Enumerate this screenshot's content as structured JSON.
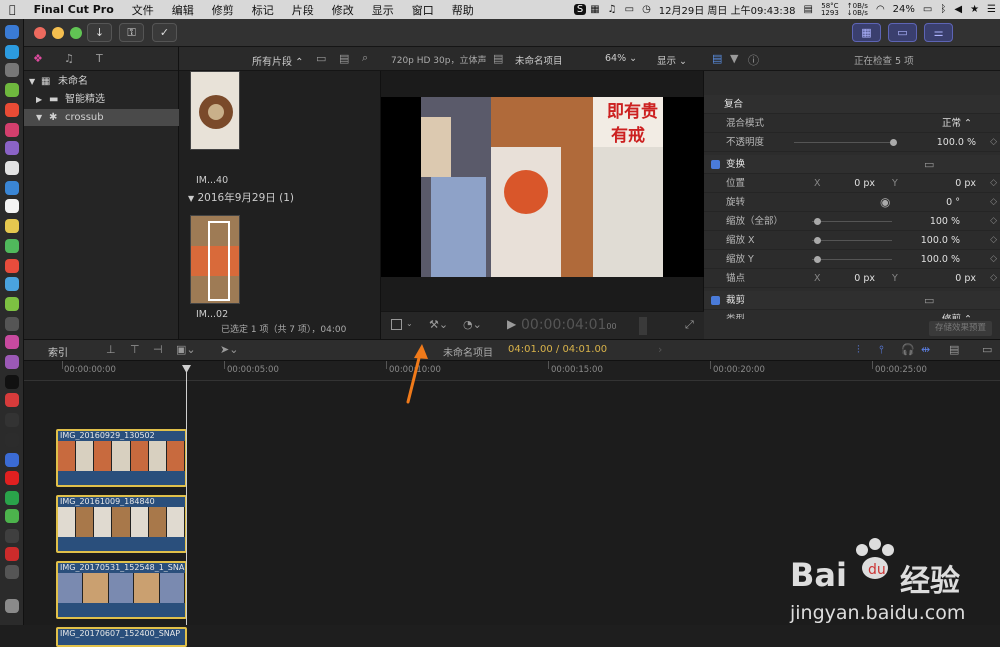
{
  "menubar": {
    "apple_icon": "apple-icon",
    "app_name": "Final Cut Pro",
    "menus": [
      "文件",
      "编辑",
      "修剪",
      "标记",
      "片段",
      "修改",
      "显示",
      "窗口",
      "帮助"
    ],
    "cpu_temp": "58°C",
    "fan_speed": "1293",
    "net_up": "0B/s",
    "net_down": "0B/s",
    "battery": "24%",
    "datetime": "12月29日 周日 上午09:43:38"
  },
  "library": {
    "root": "未命名",
    "smart": "智能精选",
    "event": "crossub"
  },
  "browser": {
    "filter_label": "所有片段 ⌃",
    "clip1_label": "IM...40",
    "date_group": "2016年9月29日",
    "date_count": "(1)",
    "clip2_label": "IM...02",
    "footer": "已选定 1 项（共 7 项），04:00"
  },
  "viewer": {
    "format": "720p HD 30p，立体声",
    "project": "未命名项目",
    "zoom": "64% ⌄",
    "display": "显示 ⌄",
    "poster_text_1": "即有贵",
    "poster_text_2": "有戒",
    "timecode": "00:00:04:01",
    "timecode_frames": "00"
  },
  "inspector": {
    "title": "正在检查 5 项",
    "composite_title": "复合",
    "blend_mode_label": "混合模式",
    "blend_mode_value": "正常 ⌃",
    "opacity_label": "不透明度",
    "opacity_value": "100.0 %",
    "opacity_level": 1.0,
    "transform_title": "变换",
    "position_label": "位置",
    "position_x_label": "X",
    "position_x": "0 px",
    "position_y_label": "Y",
    "position_y": "0 px",
    "rotation_label": "旋转",
    "rotation_value": "0 °",
    "scale_all_label": "缩放（全部）",
    "scale_all_value": "100 %",
    "scale_x_label": "缩放 X",
    "scale_x_value": "100.0 %",
    "scale_y_label": "缩放 Y",
    "scale_y_value": "100.0 %",
    "anchor_label": "锚点",
    "anchor_x_label": "X",
    "anchor_x": "0 px",
    "anchor_y_label": "Y",
    "anchor_y": "0 px",
    "crop_title": "裁剪",
    "crop_type_label": "类型",
    "crop_type_value": "修剪 ⌃",
    "save_preset": "存储效果预置"
  },
  "timeline": {
    "index_label": "索引",
    "project_name": "未命名项目",
    "duration": "04:01.00 / 04:01.00",
    "ruler": [
      "00:00:00:00",
      "00:00:05:00",
      "00:00:10:00",
      "00:00:15:00",
      "00:00:20:00",
      "00:00:25:00"
    ],
    "clips": [
      {
        "name": "IMG_20160929_130502"
      },
      {
        "name": "IMG_20161009_184840"
      },
      {
        "name": "IMG_20170531_152548_1_SNAP"
      },
      {
        "name": "IMG_20170607_152400_SNAP"
      }
    ]
  },
  "watermark": {
    "brand_left": "Bai",
    "brand_right": "经验",
    "url": "jingyan.baidu.com"
  },
  "colors": {
    "accent_blue": "#4a7bd9",
    "clip_border": "#e0c04a",
    "timecode_yellow": "#d9b34a",
    "arrow_orange": "#f07a1a"
  }
}
